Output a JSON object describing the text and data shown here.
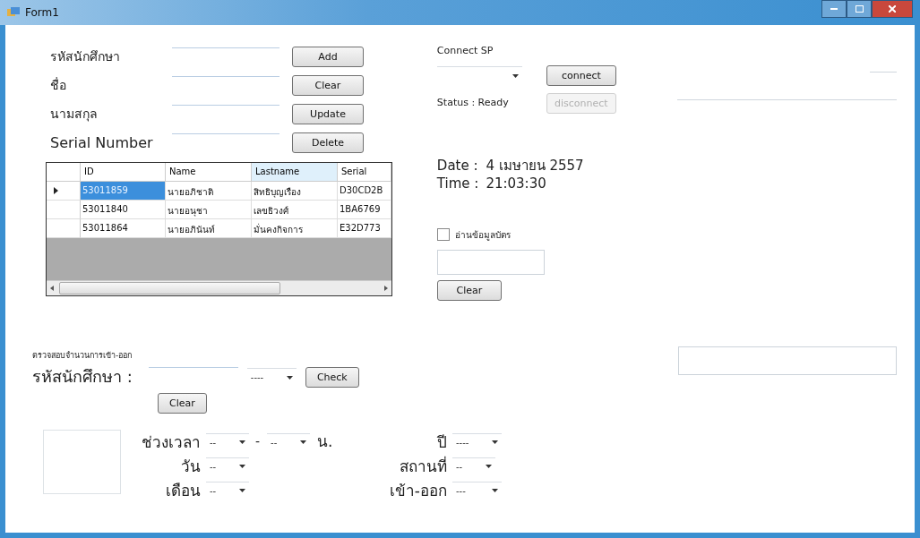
{
  "window": {
    "title": "Form1"
  },
  "student_form": {
    "fields": [
      {
        "label": "รหัสนักศึกษา"
      },
      {
        "label": "ชื่อ"
      },
      {
        "label": "นามสกุล"
      },
      {
        "label": "Serial Number"
      }
    ],
    "buttons": [
      "Add",
      "Clear",
      "Update",
      "Delete"
    ]
  },
  "grid": {
    "columns": [
      {
        "label": "ID",
        "highlighted": false
      },
      {
        "label": "Name",
        "highlighted": false
      },
      {
        "label": "Lastname",
        "highlighted": true
      },
      {
        "label": "Serial",
        "highlighted": false
      }
    ],
    "rows": [
      {
        "selected": true,
        "cells": [
          "53011859",
          "นายอภิชาติ",
          "สิทธิบุญเรือง",
          "D30CD2B"
        ]
      },
      {
        "selected": false,
        "cells": [
          "53011840",
          "นายอนุชา",
          "เลขธิวงศ์",
          "1BA6769"
        ]
      },
      {
        "selected": false,
        "cells": [
          "53011864",
          "นายอภินันท์",
          "มั่นคงกิจการ",
          "E32D773"
        ]
      }
    ]
  },
  "connection": {
    "title": "Connect SP",
    "connect_button": "connect",
    "status": "Status : Ready",
    "disconnect_button": {
      "label": "disconnect",
      "disabled": true
    }
  },
  "clock": {
    "date_label": "Date :",
    "date": "4 เมษายน 2557",
    "time_label": "Time :",
    "time": "21:03:30"
  },
  "card_reader": {
    "checkbox": {
      "label": "อ่านข้อมูลบัตร",
      "checked": false
    },
    "clear_button": "Clear"
  },
  "attendance_check": {
    "heading": "ตรวจสอบจำนวนการเข้า-ออก",
    "id_label": "รหัสนักศึกษา :",
    "combo_value": "----",
    "check_button": "Check",
    "clear_button": "Clear",
    "time_label": "ช่วงเวลา",
    "time_from": "--",
    "dash": "-",
    "time_to": "--",
    "hour_unit": "น.",
    "year_label": "ปี",
    "year": "----",
    "day_label": "วัน",
    "day": "--",
    "place_label": "สถานที่",
    "place": "--",
    "month_label": "เดือน",
    "month": "--",
    "direction_label": "เข้า-ออก",
    "direction": "---"
  }
}
